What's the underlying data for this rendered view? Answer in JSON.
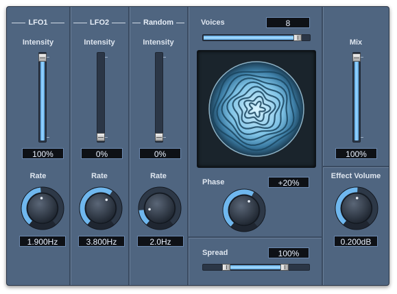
{
  "lfo1": {
    "title": "LFO1",
    "intensity_label": "Intensity",
    "intensity_value": "100%",
    "intensity_level": 1.0,
    "rate_label": "Rate",
    "rate_value": "1.900Hz",
    "rate_level": 0.48
  },
  "lfo2": {
    "title": "LFO2",
    "intensity_label": "Intensity",
    "intensity_value": "0%",
    "intensity_level": 0.0,
    "rate_label": "Rate",
    "rate_value": "3.800Hz",
    "rate_level": 0.62
  },
  "random": {
    "title": "Random",
    "intensity_label": "Intensity",
    "intensity_value": "0%",
    "intensity_level": 0.0,
    "rate_label": "Rate",
    "rate_value": "2.0Hz",
    "rate_level": 0.16
  },
  "voices": {
    "label": "Voices",
    "value": "8",
    "level": 0.93
  },
  "phase": {
    "label": "Phase",
    "value": "+20%",
    "level": 0.6
  },
  "spread": {
    "label": "Spread",
    "value": "100%",
    "level_low": 0.2,
    "level_high": 0.8
  },
  "mix": {
    "label": "Mix",
    "value": "100%",
    "level": 1.0
  },
  "effect_volume": {
    "label": "Effect Volume",
    "value": "0.200dB",
    "level": 0.51
  },
  "colors": {
    "accent": "#6fb7ee",
    "panel": "#4f6580",
    "readout_bg": "#0e1116"
  }
}
